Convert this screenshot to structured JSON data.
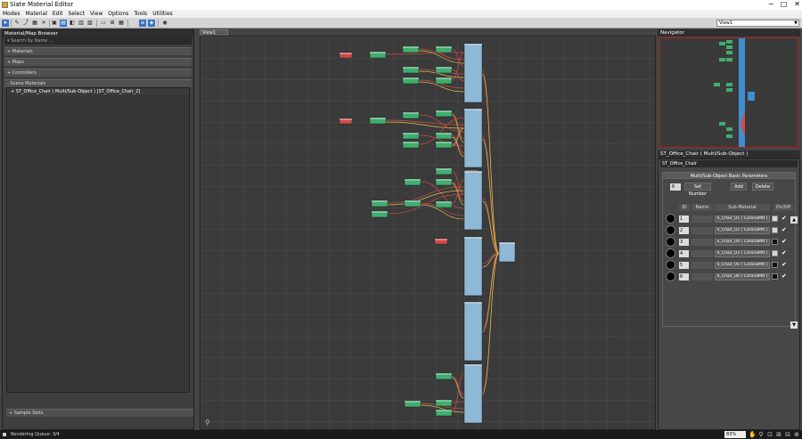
{
  "window": {
    "title": "Slate Material Editor",
    "controls": [
      "─",
      "□",
      "✕"
    ]
  },
  "menu": [
    "Modes",
    "Material",
    "Edit",
    "Select",
    "View",
    "Options",
    "Tools",
    "Utilities"
  ],
  "toolbar": {
    "view_dropdown": "View1"
  },
  "browser": {
    "title": "Material/Map Browser",
    "search_placeholder": "Search by Name ...",
    "rollouts": [
      "+ Materials",
      "+ Maps",
      "+ Controllers",
      "- Scene Materials"
    ],
    "scene_item": "ST_Office_Chair  ( Multi/Sub-Object )  [ST_Office_Chair_2]",
    "sample_slots": "+ Sample Slots"
  },
  "view": {
    "tab": "View1"
  },
  "navigator": {
    "title": "Navigator"
  },
  "params": {
    "header": "ST_Office_Chair  ( Multi/Sub-Object )",
    "name_field": "ST_Office_Chair",
    "rollout_title": "Multi/Sub-Object Basic Parameters",
    "count": "6",
    "set_number": "Set Number",
    "add": "Add",
    "delete": "Delete",
    "col_id": "ID",
    "col_name": "Name",
    "col_sub": "Sub-Material",
    "col_onoff": "On/Off",
    "rows": [
      {
        "id": "1",
        "sub": "e_Chair_01  ( CoronaMtl )",
        "color": "#d8d8d8"
      },
      {
        "id": "2",
        "sub": "e_Chair_02  ( CoronaMtl )",
        "color": "#d8d8d8"
      },
      {
        "id": "3",
        "sub": "e_Chair_04  ( CoronaMtl )",
        "color": "#111111"
      },
      {
        "id": "4",
        "sub": "e_Chair_03  ( CoronaMtl )",
        "color": "#d8d8d8"
      },
      {
        "id": "5",
        "sub": "e_Chair_05  ( CoronaMtl )",
        "color": "#111111"
      },
      {
        "id": "6",
        "sub": "e_Chair_06  ( CoronaMtl )",
        "color": "#111111"
      }
    ]
  },
  "status": {
    "text": "Rendering Queue: 3/4",
    "zoom": "83%"
  },
  "colors": {
    "node_green": "#3fae6f",
    "node_blue": "#8fb7d6",
    "wire_red": "#d24a4a",
    "wire_yellow": "#d8c24a"
  }
}
